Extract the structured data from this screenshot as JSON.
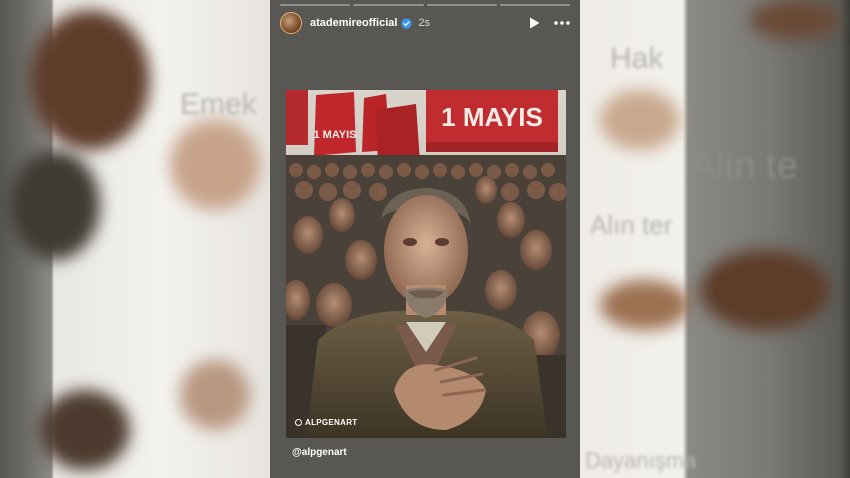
{
  "story": {
    "username": "atademireofficial",
    "timestamp": "2s",
    "progress_segments": 4,
    "progress_done": 0,
    "mention": "@alpgenart",
    "image": {
      "banner_text": "1 MAYIS",
      "small_banner_text": "1 MAYIS",
      "watermark": "ALPGENART"
    }
  },
  "background": {
    "ghost_texts": [
      "Emek",
      "Hak",
      "Alın te",
      "Alın ter",
      "Dayanışma"
    ]
  },
  "icons": {
    "verified": "verified-badge-icon",
    "play": "play-icon",
    "more": "more-options-icon"
  },
  "colors": {
    "banner_red": "#c0272d",
    "panel_bg": "#585753",
    "verified_blue": "#3897f0"
  }
}
